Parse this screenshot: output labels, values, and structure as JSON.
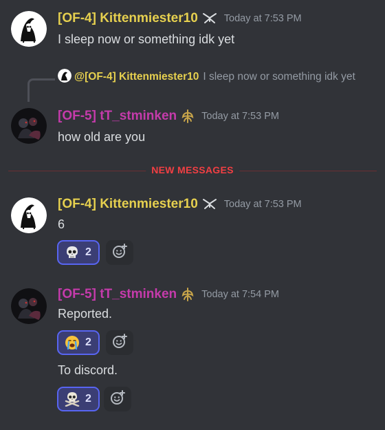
{
  "messages": [
    {
      "author": "[OF-4] Kittenmiester10",
      "timestamp": "Today at 7:53 PM",
      "text": "I sleep now or something idk yet"
    },
    {
      "reply_to": {
        "author": "@[OF-4] Kittenmiester10",
        "text": "I sleep now or something idk yet"
      },
      "author": "[OF-5] tT_stminken",
      "timestamp": "Today at 7:53 PM",
      "text": "how old are you"
    },
    {
      "author": "[OF-4] Kittenmiester10",
      "timestamp": "Today at 7:53 PM",
      "text": "6",
      "reactions": [
        {
          "emoji": "skull-emoji",
          "count": "2"
        }
      ]
    },
    {
      "author": "[OF-5] tT_stminken",
      "timestamp": "Today at 7:54 PM",
      "text": "Reported.",
      "reactions": [
        {
          "emoji": "loudly-crying-emoji",
          "count": "2"
        }
      ],
      "followup_text": "To discord.",
      "followup_reactions": [
        {
          "emoji": "skull-and-crossbones-emoji",
          "count": "2"
        }
      ]
    }
  ],
  "divider": {
    "label": "NEW MESSAGES"
  },
  "colors": {
    "background": "#313338",
    "role_of4": "#e6d04f",
    "role_of5": "#c53bab",
    "new_messages": "#f23f43",
    "reaction_border": "#5865f2"
  }
}
